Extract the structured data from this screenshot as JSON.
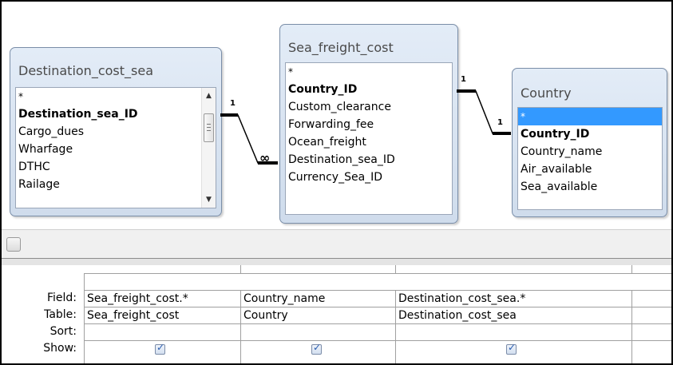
{
  "tables": {
    "destination": {
      "title": "Destination_cost_sea",
      "fields": [
        "*",
        "Destination_sea_ID",
        "Cargo_dues",
        "Wharfage",
        "DTHC",
        "Railage"
      ]
    },
    "sea_freight": {
      "title": "Sea_freight_cost",
      "fields": [
        "*",
        "Country_ID",
        "Custom_clearance",
        "Forwarding_fee",
        "Ocean_freight",
        "Destination_sea_ID",
        "Currency_Sea_ID"
      ]
    },
    "country": {
      "title": "Country",
      "fields": [
        "*",
        "Country_ID",
        "Country_name",
        "Air_available",
        "Sea_available"
      ]
    }
  },
  "joins": {
    "dest_one": "1",
    "dest_many": "∞",
    "sea_one": "1",
    "country_one": "1"
  },
  "grid": {
    "row_labels": {
      "field": "Field:",
      "table": "Table:",
      "sort": "Sort:",
      "show": "Show:"
    },
    "columns": [
      {
        "field": "Sea_freight_cost.*",
        "table": "Sea_freight_cost",
        "sort": "",
        "show": true
      },
      {
        "field": "Country_name",
        "table": "Country",
        "sort": "",
        "show": true
      },
      {
        "field": "Destination_cost_sea.*",
        "table": "Destination_cost_sea",
        "sort": "",
        "show": true
      },
      {
        "field": "",
        "table": "",
        "sort": "",
        "show": false
      }
    ]
  },
  "colors": {
    "table_bg": "#d5e2f1",
    "selection": "#3399ff"
  }
}
